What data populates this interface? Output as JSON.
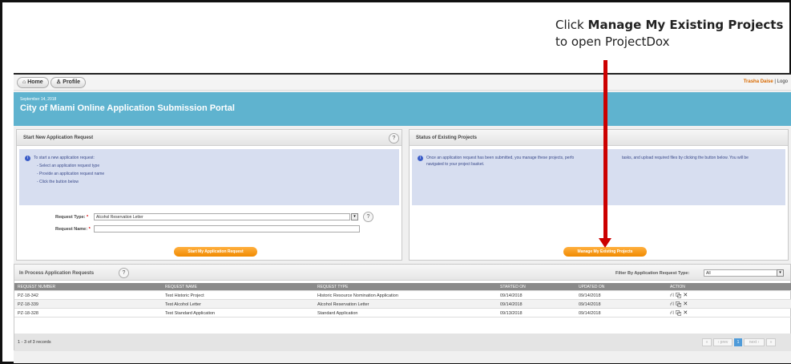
{
  "callout": {
    "line1_prefix": "Click ",
    "line1_bold": "Manage My Existing Projects",
    "line2": "to open ProjectDox"
  },
  "nav": {
    "home": "Home",
    "profile": "Profile",
    "user": "Trasha Daise",
    "sep": "|",
    "logout": "Logo"
  },
  "banner": {
    "date": "September 14, 2018",
    "title": "City of Miami Online Application Submission Portal"
  },
  "new_app": {
    "header": "Start New Application Request",
    "help": "?",
    "info_title": "To start a new application request:",
    "steps": [
      "- Select an application request type",
      "- Provide an application request name",
      "- Click the button below"
    ],
    "type_label": "Request Type:",
    "type_value": "Alcohol Reservation Letter",
    "name_label": "Request Name:",
    "name_value": "",
    "required_mark": "*",
    "button": "Start My Application Request"
  },
  "status": {
    "header": "Status of Existing Projects",
    "info_line1": "Once an application request has been submitted, you manage these projects, perfo",
    "info_line1b": "tasks, and upload required files by clicking the button below. You will be",
    "info_line2": "navigated to your project basket.",
    "button": "Manage My Existing Projects"
  },
  "in_process": {
    "header": "In Process Application Requests",
    "help": "?",
    "filter_label": "Filter By Application Request Type:",
    "filter_value": "All",
    "columns": [
      "REQUEST NUMBER",
      "REQUEST NAME",
      "REQUEST TYPE",
      "STARTED ON",
      "UPDATED ON",
      "ACTION"
    ],
    "rows": [
      [
        "PZ-18-342",
        "Test Historic Project",
        "Historic Resource Nomination Application",
        "09/14/2018",
        "09/14/2018"
      ],
      [
        "PZ-18-339",
        "Test Alcohol Letter",
        "Alcohol Reservation Letter",
        "09/14/2018",
        "09/14/2018"
      ],
      [
        "PZ-18-328",
        "Test Standard Application",
        "Standard Application",
        "09/13/2018",
        "09/14/2018"
      ]
    ],
    "record_count": "1 - 3 of 3 records",
    "pager": {
      "prev": "‹ prev",
      "page": "1",
      "next": "next ›"
    }
  },
  "colors": {
    "accent": "#5fb3cf",
    "button": "#f08a00",
    "arrow": "#cc0000"
  }
}
